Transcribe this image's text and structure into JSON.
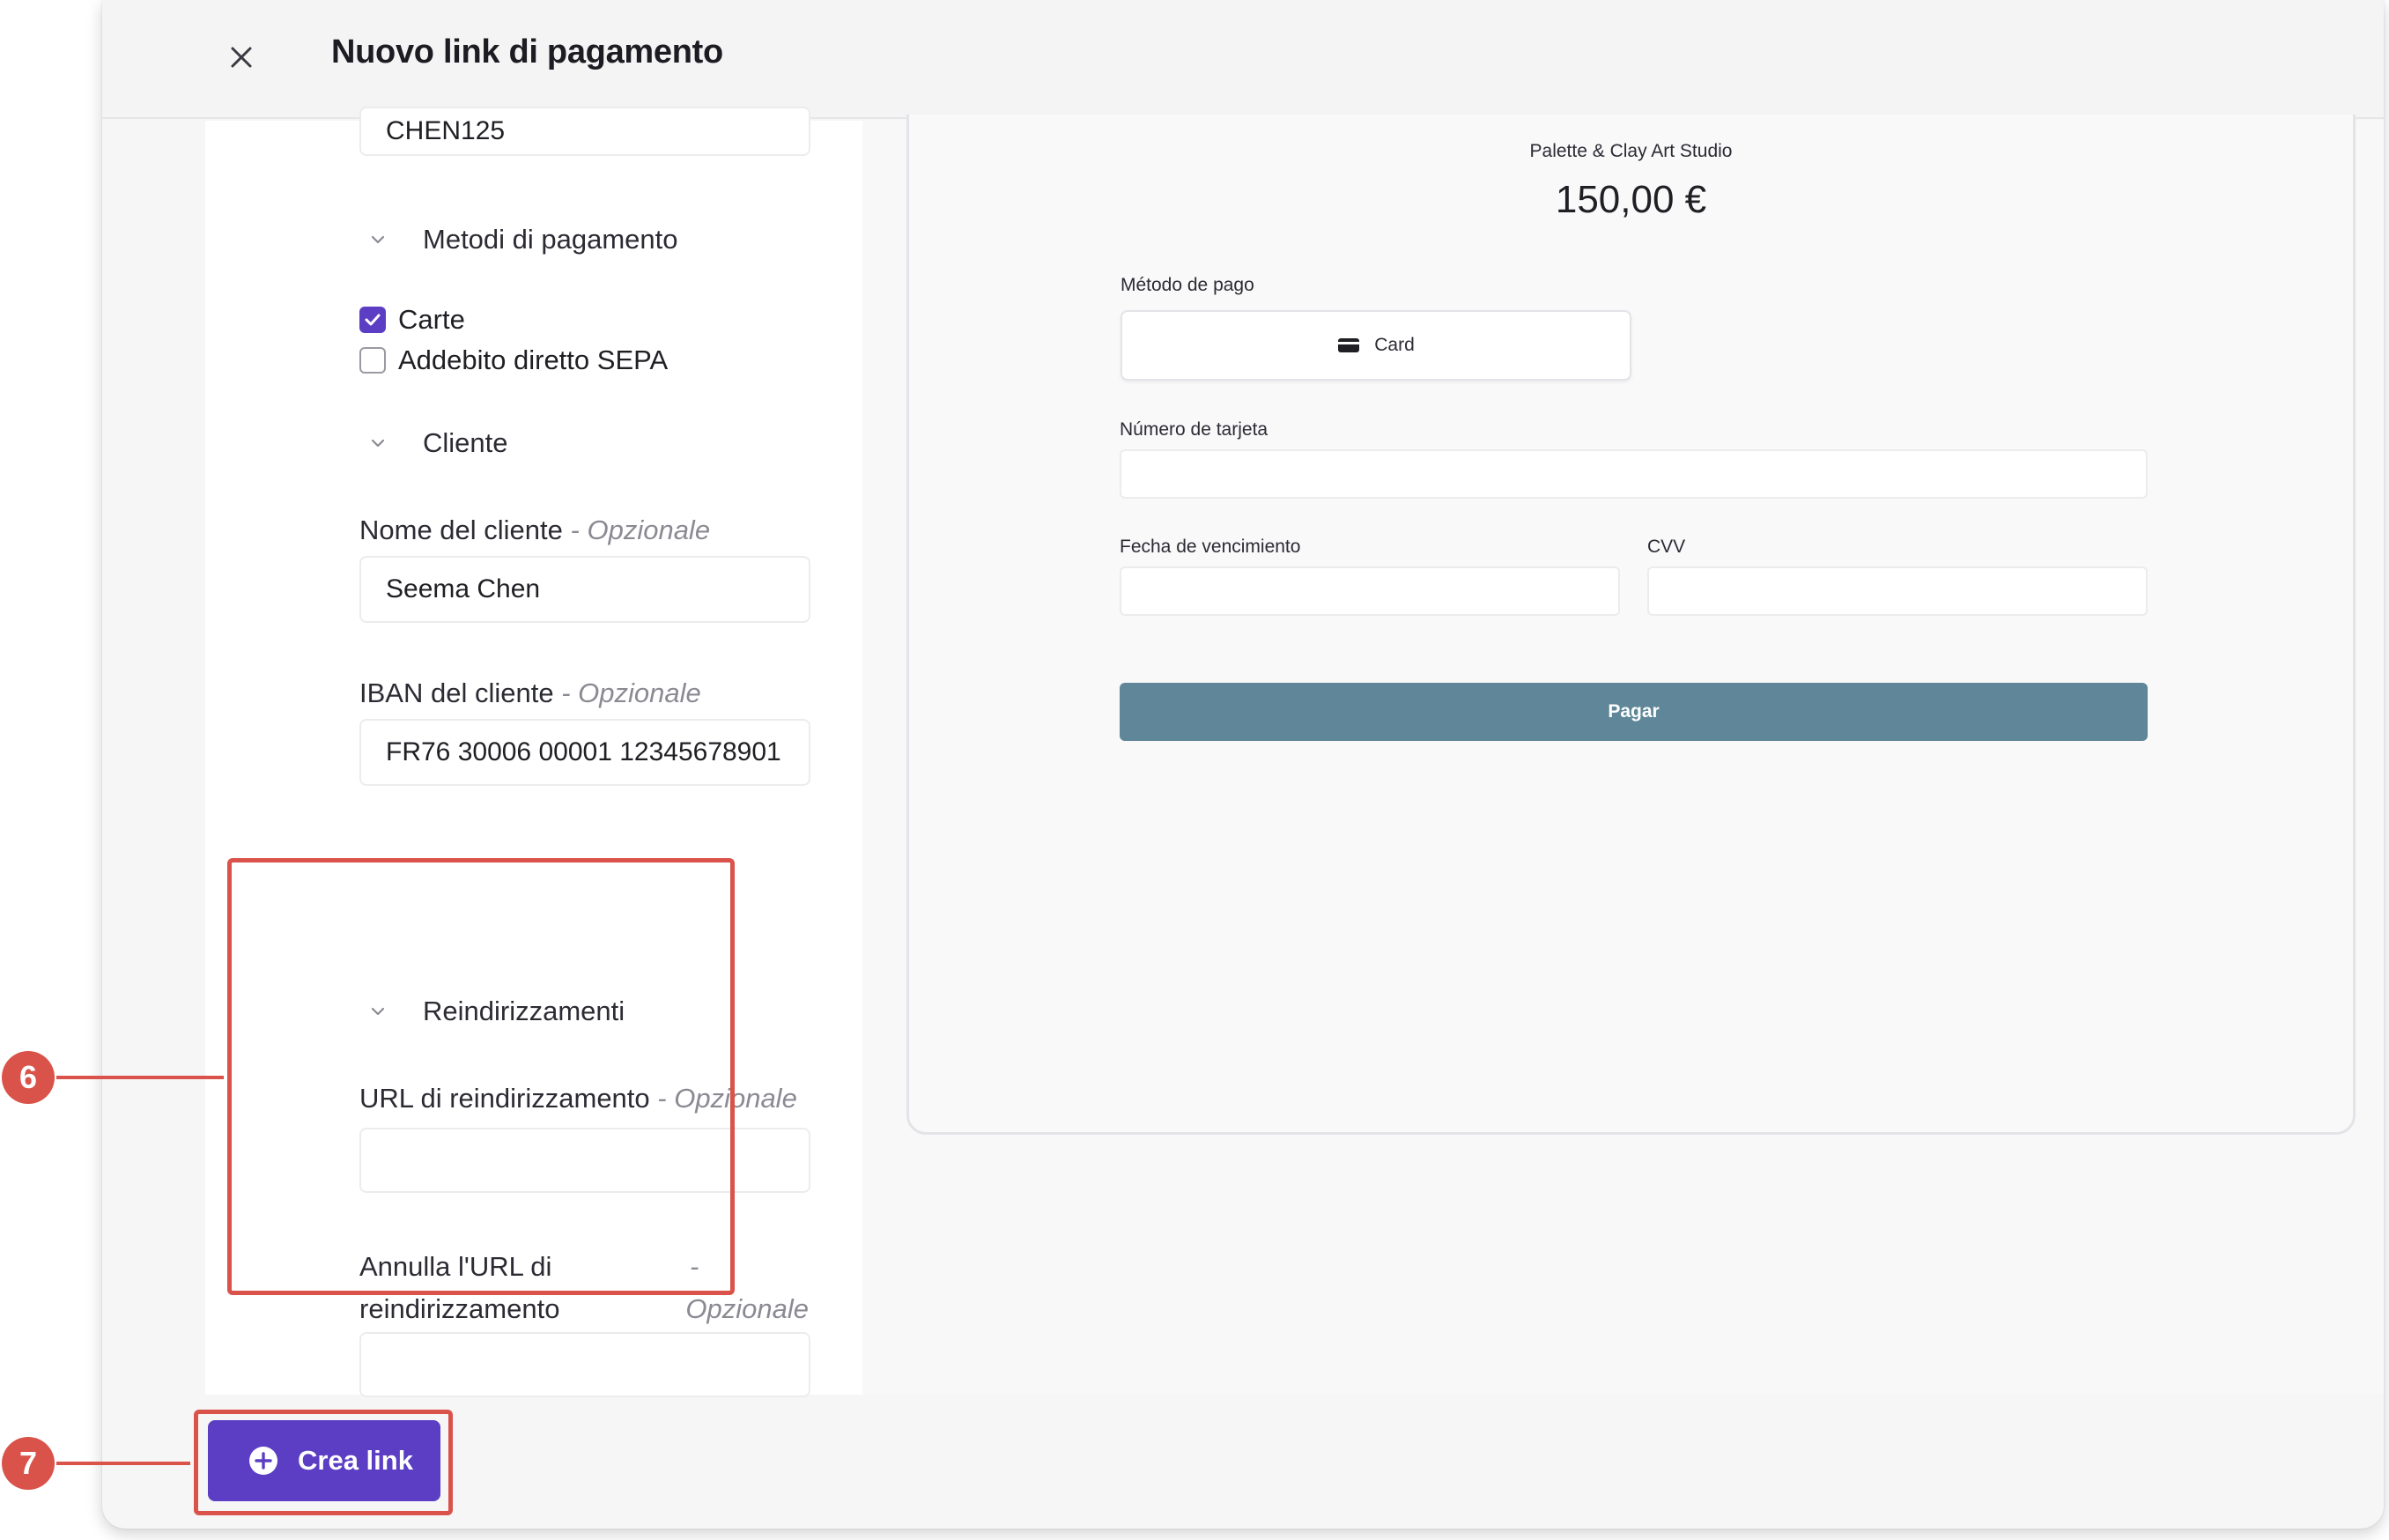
{
  "header": {
    "title": "Nuovo link di pagamento",
    "close_icon": "close-icon"
  },
  "form": {
    "reference_value": "CHEN125",
    "payment_methods": {
      "title": "Metodi di pagamento",
      "options": [
        {
          "label": "Carte",
          "checked": true
        },
        {
          "label": "Addebito diretto SEPA",
          "checked": false
        }
      ]
    },
    "customer": {
      "title": "Cliente",
      "name_label": "Nome del cliente",
      "name_value": "Seema Chen",
      "iban_label": "IBAN del cliente",
      "iban_value": "FR76 30006 00001 12345678901",
      "optional": "- Opzionale"
    },
    "redirects": {
      "title": "Reindirizzamenti",
      "redirect_url_label": "URL di reindirizzamento",
      "redirect_url_value": "",
      "cancel_url_label_line1": "Annulla l'URL di",
      "cancel_url_label_line2": "reindirizzamento",
      "cancel_optional_dash": "-",
      "cancel_optional_text": "Opzionale",
      "cancel_url_value": "",
      "optional": "- Opzionale"
    }
  },
  "preview": {
    "merchant": "Palette & Clay Art Studio",
    "amount": "150,00 €",
    "method_label": "Método de pago",
    "method_tab": "Card",
    "card_number_label": "Número de tarjeta",
    "expiry_label": "Fecha de vencimiento",
    "cvv_label": "CVV",
    "pay_button": "Pagar"
  },
  "footer": {
    "create_button": "Crea link"
  },
  "annotations": {
    "callout_6": "6",
    "callout_7": "7"
  },
  "colors": {
    "accent": "#5b3ec3",
    "pay_button": "#5f8799",
    "annotation": "#d9534a"
  }
}
